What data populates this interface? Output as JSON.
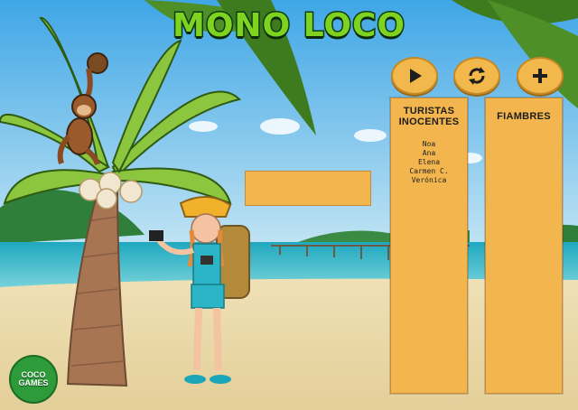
{
  "game": {
    "title": "MONO LOCO"
  },
  "controls": [
    {
      "name": "play",
      "icon": "play-icon"
    },
    {
      "name": "refresh",
      "icon": "refresh-icon"
    },
    {
      "name": "add",
      "icon": "plus-icon"
    }
  ],
  "panels": {
    "turistas": {
      "title_line1": "TURISTAS",
      "title_line2": "INOCENTES",
      "items": [
        "Noa",
        "Ana",
        "Elena",
        "Carmen C.",
        "Verónica"
      ]
    },
    "fiambres": {
      "title": "FIAMBRES"
    }
  },
  "word_box": {
    "value": ""
  },
  "logo": {
    "line1": "COCO",
    "line2": "GAMES"
  },
  "colors": {
    "panel": "#f3b54d",
    "title_green": "#7ed321",
    "title_outline": "#0f3d12",
    "sky": "#6fbfe8",
    "sea": "#2fb6c8",
    "sand": "#ecd9a8"
  }
}
